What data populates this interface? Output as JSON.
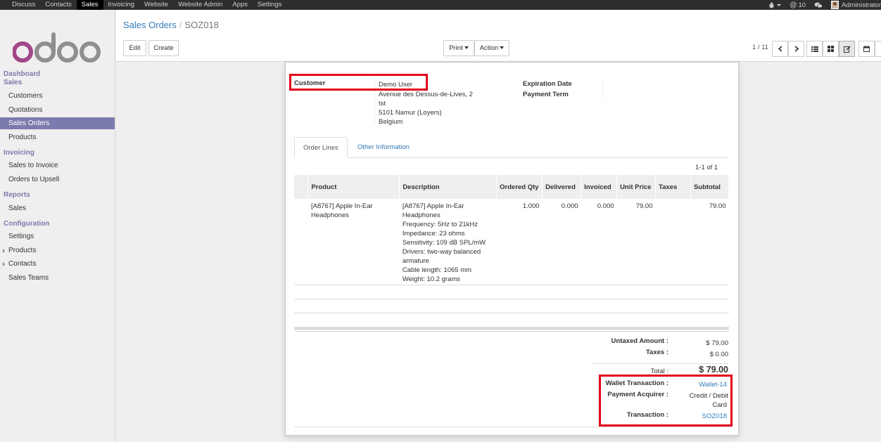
{
  "topbar": {
    "menu": [
      "Discuss",
      "Contacts",
      "Sales",
      "Invoicing",
      "Website",
      "Website Admin",
      "Apps",
      "Settings"
    ],
    "active": "Sales",
    "mentions": "10",
    "user": "Administrator"
  },
  "sidebar": {
    "dashboard": "Dashboard",
    "sales_head": "Sales",
    "customers": "Customers",
    "quotations": "Quotations",
    "sales_orders": "Sales Orders",
    "products": "Products",
    "invoicing_head": "Invoicing",
    "sales_to_invoice": "Sales to Invoice",
    "orders_to_upsell": "Orders to Upsell",
    "reports_head": "Reports",
    "reports_sales": "Sales",
    "config_head": "Configuration",
    "settings": "Settings",
    "cfg_products": "Products",
    "cfg_contacts": "Contacts",
    "sales_teams": "Sales Teams"
  },
  "control": {
    "breadcrumb_parent": "Sales Orders",
    "breadcrumb_sep": "/",
    "breadcrumb_current": "SOZ018",
    "edit": "Edit",
    "create": "Create",
    "print": "Print",
    "action": "Action",
    "pager": "1 / 11"
  },
  "form": {
    "customer_label": "Customer",
    "customer_name": "Demo User",
    "address": [
      "Avenue des Dessus-de-Lives, 2",
      "tst",
      "5101 Namur (Loyers)",
      "Belgium"
    ],
    "expiration_label": "Expiration Date",
    "payment_term_label": "Payment Term",
    "tab_order_lines": "Order Lines",
    "tab_other": "Other Information",
    "record_count": "1-1 of 1"
  },
  "table": {
    "headers": [
      "Product",
      "Description",
      "Ordered Qty",
      "Delivered",
      "Invoiced",
      "Unit Price",
      "Taxes",
      "Subtotal"
    ],
    "row": {
      "product": "[A8767] Apple In-Ear Headphones",
      "description": [
        "[A8767] Apple In-Ear Headphones",
        "Frequency: 5Hz to 21kHz",
        "Impedance: 23 ohms",
        "Sensitivity: 109 dB SPL/mW",
        "Drivers: two-way balanced armature",
        "Cable length: 1065 mm",
        "Weight: 10.2 grams"
      ],
      "ordered_qty": "1.000",
      "delivered": "0.000",
      "invoiced": "0.000",
      "unit_price": "79.00",
      "taxes": "",
      "subtotal": "79.00"
    }
  },
  "totals": {
    "untaxed_label": "Untaxed Amount :",
    "untaxed_value": "$ 79.00",
    "taxes_label": "Taxes :",
    "taxes_value": "$ 0.00",
    "total_label": "Total :",
    "total_value": "$ 79.00",
    "wallet_label": "Wallet Transaction :",
    "wallet_value": "Wallet-14",
    "acquirer_label": "Payment Acquirer :",
    "acquirer_value_1": "Credit / Debit",
    "acquirer_value_2": "Card",
    "transaction_label": "Transaction :",
    "transaction_value": "SOZ018"
  },
  "colors": {
    "brand": "#7c7bad",
    "link": "#337ab7",
    "highlight": "#e3001b",
    "topbar": "#2e2e2e"
  }
}
